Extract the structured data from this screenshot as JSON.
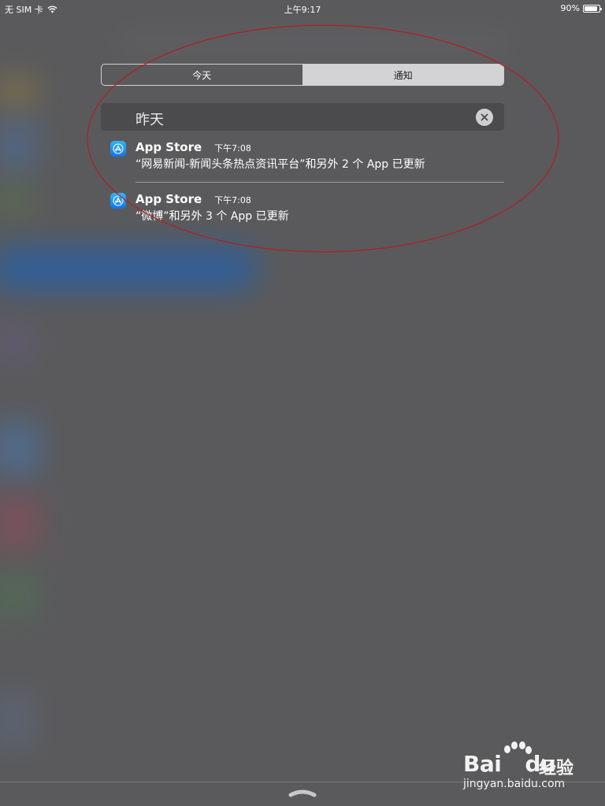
{
  "status_bar": {
    "carrier": "无 SIM 卡",
    "time": "上午9:17",
    "battery_percent": "90%",
    "battery_level": 0.9
  },
  "segmented": {
    "today_label": "今天",
    "notifications_label": "通知",
    "selected": "通知"
  },
  "section": {
    "title": "昨天"
  },
  "notifications": [
    {
      "app": "App Store",
      "time": "下午7:08",
      "body": "“网易新闻-新闻头条热点资讯平台”和另外 2 个 App 已更新",
      "icon": "app-store-icon"
    },
    {
      "app": "App Store",
      "time": "下午7:08",
      "body": "“微博”和另外 3 个 App 已更新",
      "icon": "app-store-icon"
    }
  ],
  "watermark": {
    "logo": "Bai",
    "logo_suffix": "du",
    "product": "经验",
    "url": "jingyan.baidu.com"
  },
  "colors": {
    "background": "#5a5a5c",
    "annotation": "#b01e23",
    "app_store_icon": "#1e90f0"
  }
}
